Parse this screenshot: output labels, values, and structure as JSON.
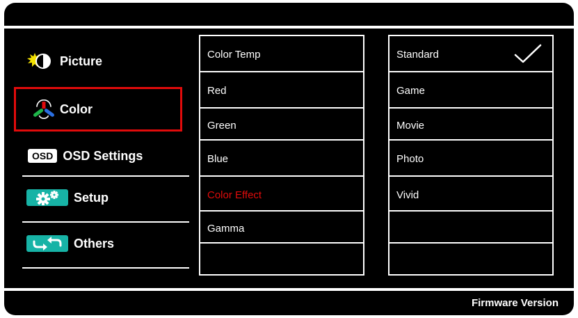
{
  "sidebar": {
    "items": [
      {
        "name": "picture",
        "label": "Picture",
        "icon": "picture-icon"
      },
      {
        "name": "color",
        "label": "Color",
        "icon": "color-icon",
        "selected": true
      },
      {
        "name": "osd-settings",
        "label": "OSD Settings",
        "icon": "osd-icon",
        "badge": "OSD"
      },
      {
        "name": "setup",
        "label": "Setup",
        "icon": "gears-icon"
      },
      {
        "name": "others",
        "label": "Others",
        "icon": "arrows-icon"
      }
    ]
  },
  "submenu": {
    "items": [
      {
        "label": "Color Temp"
      },
      {
        "label": "Red"
      },
      {
        "label": "Green"
      },
      {
        "label": "Blue"
      },
      {
        "label": "Color Effect",
        "active": true
      },
      {
        "label": "Gamma"
      },
      {
        "label": ""
      }
    ]
  },
  "options": {
    "items": [
      {
        "label": "Standard",
        "checked": true
      },
      {
        "label": "Game"
      },
      {
        "label": "Movie"
      },
      {
        "label": "Photo"
      },
      {
        "label": "Vivid"
      },
      {
        "label": ""
      },
      {
        "label": ""
      }
    ]
  },
  "footer": {
    "firmware_label": "Firmware Version"
  },
  "colors": {
    "background": "#000000",
    "foreground": "#ffffff",
    "accent_red": "#e10b0b",
    "badge_teal": "#17b3a6"
  }
}
